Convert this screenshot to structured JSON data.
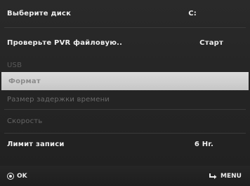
{
  "menu": {
    "items": [
      {
        "label": "Выберите диск",
        "value": "C:",
        "state": "normal"
      },
      {
        "label": "Проверьте PVR файловую..",
        "value": "Старт",
        "state": "normal"
      },
      {
        "label": "USB",
        "value": "",
        "state": "disabled"
      },
      {
        "label": "Формат",
        "value": "",
        "state": "selected"
      },
      {
        "label": "Размер задержки времени",
        "value": "",
        "state": "disabled"
      },
      {
        "label": "Скорость",
        "value": "",
        "state": "disabled"
      },
      {
        "label": "Лимит записи",
        "value": "6 Hr.",
        "state": "normal"
      }
    ]
  },
  "footer": {
    "ok_label": "OK",
    "menu_label": "MENU",
    "ok_icon": "ok-circle-icon",
    "menu_icon": "return-arrow-icon"
  },
  "colors": {
    "background": "#252525",
    "selected_row": "#d2d2d2",
    "text": "#efefef",
    "disabled_text": "#666666"
  }
}
